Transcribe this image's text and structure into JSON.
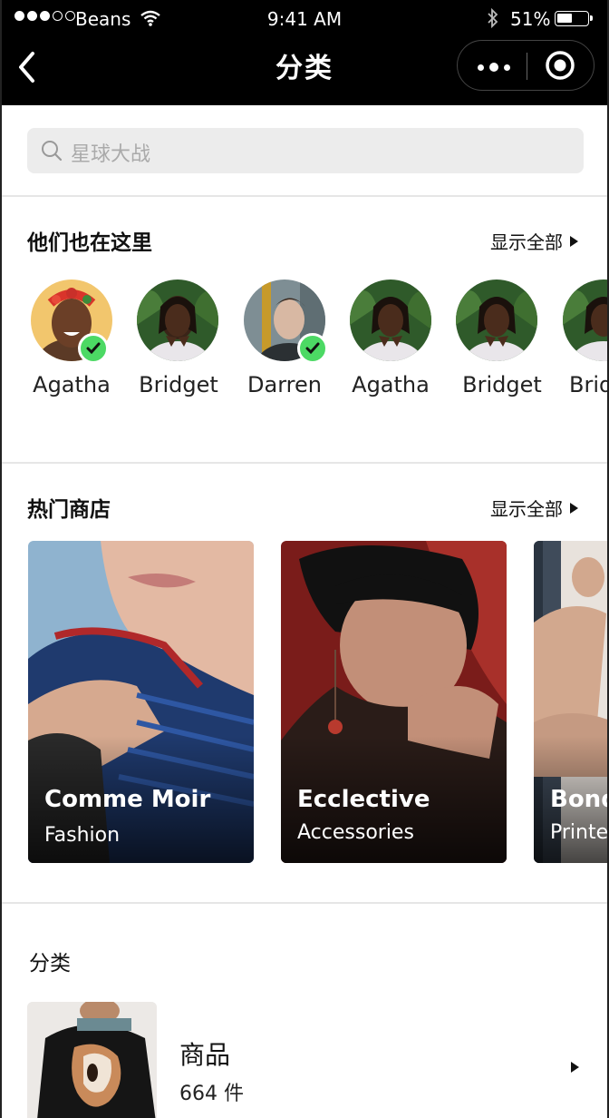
{
  "status_bar": {
    "carrier": "Beans",
    "time": "9:41 AM",
    "battery": "51%"
  },
  "nav": {
    "title": "分类"
  },
  "search": {
    "placeholder": "星球大战"
  },
  "people_section": {
    "title": "他们也在这里",
    "show_all": "显示全部",
    "people": [
      {
        "name": "Agatha",
        "verified": true
      },
      {
        "name": "Bridget",
        "verified": false
      },
      {
        "name": "Darren",
        "verified": true
      },
      {
        "name": "Agatha",
        "verified": false
      },
      {
        "name": "Bridget",
        "verified": false
      },
      {
        "name": "Bridget",
        "verified": false
      }
    ]
  },
  "stores_section": {
    "title": "热门商店",
    "show_all": "显示全部",
    "stores": [
      {
        "name": "Comme Moir",
        "category": "Fashion"
      },
      {
        "name": "Ecclective",
        "category": "Accessories"
      },
      {
        "name": "Bonds",
        "category": "Printed"
      }
    ]
  },
  "category_section": {
    "title": "分类",
    "items": [
      {
        "name": "商品",
        "count": "664 件"
      }
    ]
  },
  "colors": {
    "topbar": "#000000",
    "search_bg": "#ececec",
    "verified": "#4cd964"
  }
}
